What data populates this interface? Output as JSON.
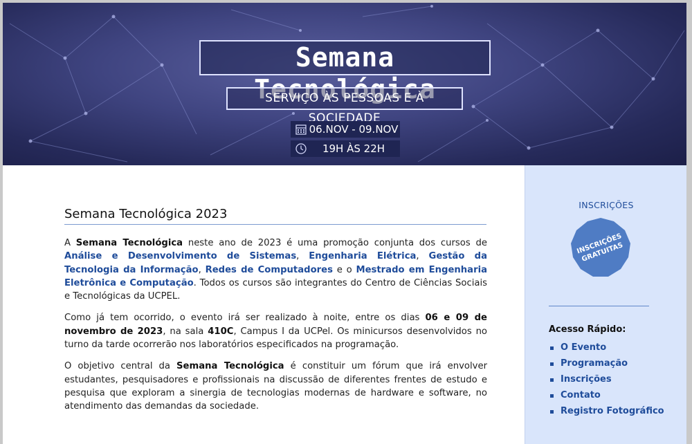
{
  "banner": {
    "title": "Semana Tecnológica",
    "subtitle": "SERVIÇO ÀS PESSOAS E À SOCIEDADE",
    "dates": "06.NOV - 09.NOV",
    "hours": "19H ÀS 22H",
    "icons": [
      "calendar-icon",
      "clock-icon"
    ]
  },
  "main": {
    "heading": "Semana Tecnológica 2023",
    "p1": {
      "t1": "A ",
      "b1": "Semana Tecnológica",
      "t2": " neste ano de 2023 é uma promoção conjunta dos cursos de ",
      "l1": "Análise e Desenvolvimento de Sistemas",
      "t3": ", ",
      "l2": "Engenharia Elétrica",
      "t4": ", ",
      "l3": "Gestão da Tecnologia da Informação",
      "t5": ", ",
      "l4": "Redes de Computadores",
      "t6": " e o ",
      "l5": "Mestrado em Engenharia Eletrônica e Computação",
      "t7": ". Todos os cursos são integrantes do Centro de Ciências Sociais e Tecnológicas da UCPEL."
    },
    "p2": {
      "t1": "Como já tem ocorrido, o evento irá ser realizado à noite, entre os dias ",
      "b1": "06 e 09 de novembro de 2023",
      "t2": ", na sala ",
      "b2": "410C",
      "t3": ", Campus I da UCPel. Os minicursos desenvolvidos no turno da tarde ocorrerão nos laboratórios especificados na programação."
    },
    "p3": {
      "t1": "O objetivo central da ",
      "b1": "Semana Tecnológica",
      "t2": " é constituir um fórum que irá envolver estudantes, pesquisadores e profissionais na discussão de diferentes frentes de estudo e pesquisa que exploram a sinergia de tecnologias modernas de hardware e software, no atendimento das demandas da sociedade."
    }
  },
  "sidebar": {
    "section_label": "INSCRIÇÕES",
    "badge_line1": "INSCRIÇÕES",
    "badge_line2": "GRATUITAS",
    "quick_title": "Acesso Rápido:",
    "quick_links": [
      "O Evento",
      "Programação",
      "Inscrições",
      "Contato",
      "Registro Fotográfico"
    ]
  },
  "colors": {
    "link": "#1f4c9a",
    "sidebar_bg": "#d9e5fb",
    "banner_bg": "#2e3370",
    "badge": "#4f7cc4"
  }
}
